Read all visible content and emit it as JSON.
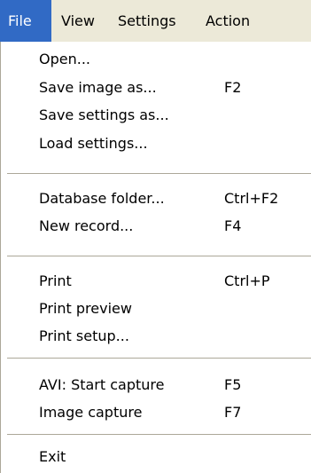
{
  "menubar": {
    "file": "File",
    "view": "View",
    "settings": "Settings",
    "action": "Action"
  },
  "file_menu": {
    "open": "Open...",
    "save_image_as": "Save image as...",
    "save_image_as_shortcut": "F2",
    "save_settings_as": "Save settings as...",
    "load_settings": "Load settings...",
    "database_folder": "Database folder...",
    "database_folder_shortcut": "Ctrl+F2",
    "new_record": "New record...",
    "new_record_shortcut": "F4",
    "print": "Print",
    "print_shortcut": "Ctrl+P",
    "print_preview": "Print preview",
    "print_setup": "Print setup...",
    "avi_start_capture": "AVI: Start capture",
    "avi_start_capture_shortcut": "F5",
    "image_capture": "Image capture",
    "image_capture_shortcut": "F7",
    "exit": "Exit"
  },
  "colors": {
    "menubar_bg": "#ece9d8",
    "highlight": "#316ac5",
    "separator": "#aca899"
  }
}
